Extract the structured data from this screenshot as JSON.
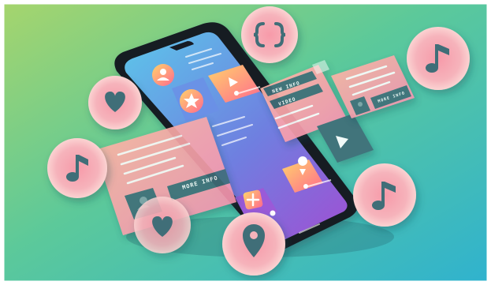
{
  "illustration": {
    "description_note": "",
    "card_left_button_label": "MORE INFO",
    "card_right_button_label": "MORE INFO",
    "card_right_tab_1": "NEW INFO",
    "card_right_tab_2": "VIDEO"
  },
  "icons": [
    "code-braces-icon",
    "music-note-icon",
    "heart-icon",
    "music-note-icon",
    "music-note-icon",
    "location-pin-icon",
    "heart-icon",
    "user-icon",
    "star-icon",
    "play-icon",
    "plus-icon"
  ],
  "colors": {
    "bg_top_left": "#9fd36a",
    "bg_bottom_right": "#34b7c9",
    "phone_body": "#1b1f2a",
    "screen_top": "#57c4e8",
    "screen_bottom": "#9a52d6",
    "bubble_outer": "#f7c6c9",
    "bubble_inner": "#f39aa6",
    "card_pink": "#f7a5b0",
    "card_dark": "#3f6e78"
  }
}
